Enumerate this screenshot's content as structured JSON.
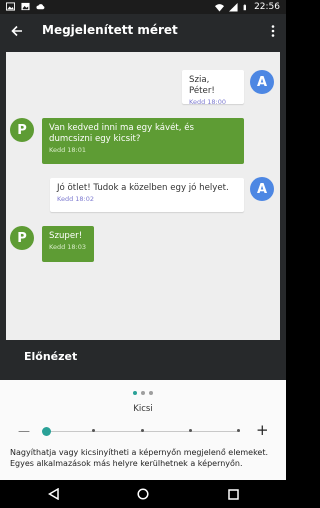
{
  "status_bar": {
    "time": "22:56",
    "left_icons": [
      "gallery-icon",
      "image-icon",
      "cloud-icon"
    ],
    "right_icons": [
      "wifi-icon",
      "signal-icon",
      "battery-icon"
    ]
  },
  "toolbar": {
    "title": "Megjelenített méret",
    "back_icon": "arrow-back-icon",
    "menu_icon": "more-vert-icon"
  },
  "chat": {
    "messages": [
      {
        "side": "out",
        "text": "Szia, Péter!",
        "time": "Kedd 18:00",
        "avatar": "A"
      },
      {
        "side": "in",
        "text": "Van kedved inni ma egy kávét, és dumcsizni egy kicsit?",
        "time": "Kedd 18:01",
        "avatar": "P"
      },
      {
        "side": "out",
        "text": "Jó ötlet! Tudok a közelben egy jó helyet.",
        "time": "Kedd 18:02",
        "avatar": "A"
      },
      {
        "side": "in",
        "text": "Szuper!",
        "time": "Kedd 18:03",
        "avatar": "P"
      }
    ]
  },
  "preview_label": "Előnézet",
  "size_selector": {
    "page_count": 3,
    "current_page": 1,
    "current_label": "Kicsi",
    "minus_label": "—",
    "plus_label": "+",
    "steps": 5,
    "selected_step": 0,
    "description": "Nagyíthatja vagy kicsinyítheti a képernyőn megjelenő elemeket. Egyes alkalmazások más helyre kerülhetnek a képernyőn."
  },
  "colors": {
    "accent": "#2aa197",
    "bubble_in": "#5e9c34",
    "avatar_a": "#4d87e3",
    "toolbar": "#27292b"
  },
  "nav_bar": {
    "icons": [
      "back-triangle-icon",
      "home-circle-icon",
      "recents-square-icon"
    ]
  }
}
